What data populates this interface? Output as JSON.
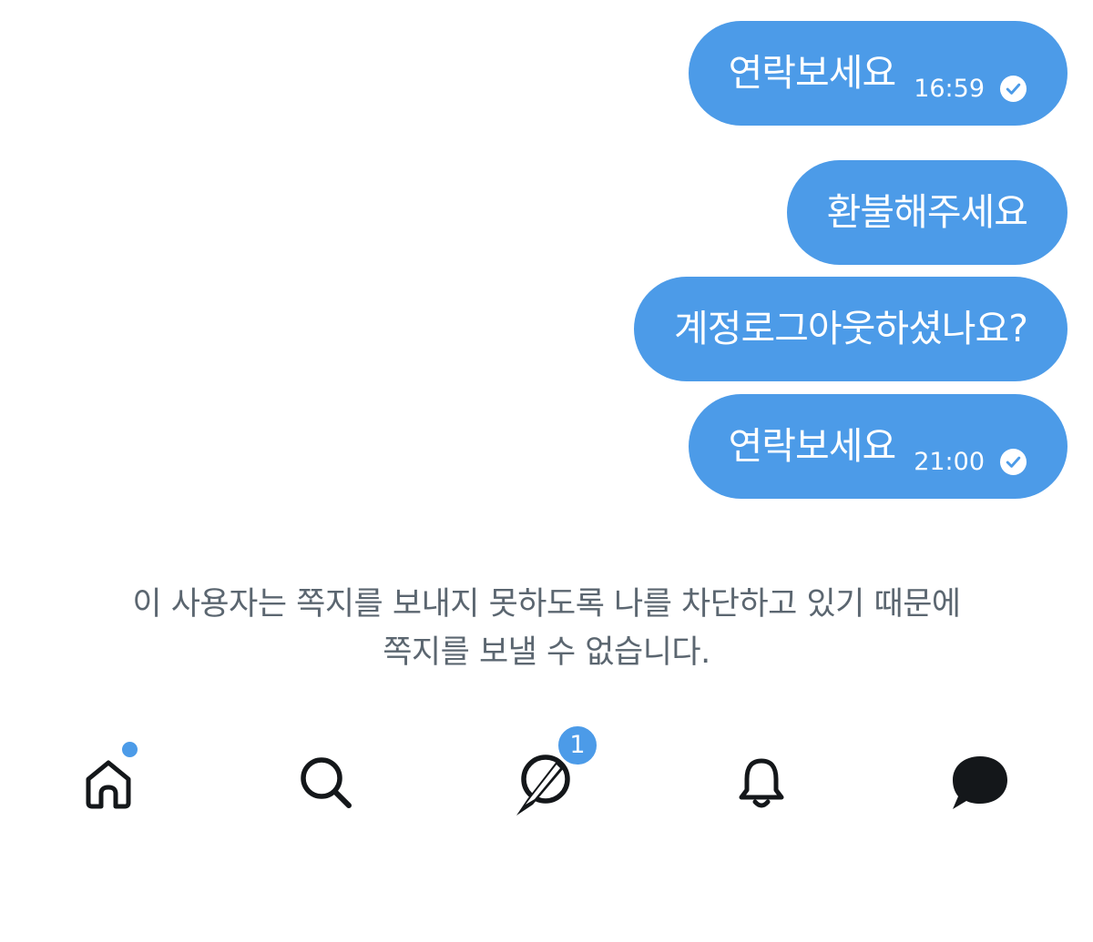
{
  "messages": [
    {
      "text": "연락보세요",
      "time": "16:59",
      "status_icon": "read-check-icon"
    },
    {
      "text": "환불해주세요",
      "time": "",
      "status_icon": ""
    },
    {
      "text": "계정로그아웃하셨나요?",
      "time": "",
      "status_icon": ""
    },
    {
      "text": "연락보세요",
      "time": "21:00",
      "status_icon": "read-check-icon"
    }
  ],
  "blocked_notice": {
    "line1": "이 사용자는 쪽지를 보내지 못하도록 나를 차단하고 있기 때문에",
    "line2": "쪽지를 보낼 수 없습니다."
  },
  "tabbar": {
    "items": [
      {
        "name": "home",
        "icon": "home-icon",
        "has_dot": true
      },
      {
        "name": "search",
        "icon": "search-icon"
      },
      {
        "name": "spaces",
        "icon": "spaces-icon",
        "badge": "1"
      },
      {
        "name": "notifications",
        "icon": "bell-icon"
      },
      {
        "name": "messages",
        "icon": "chat-bubble-icon"
      }
    ]
  },
  "colors": {
    "bubble": "#4c9be8",
    "bubble_text": "#ffffff",
    "notice_text": "#5b6670",
    "icon": "#14171a",
    "badge": "#4c9be8"
  }
}
